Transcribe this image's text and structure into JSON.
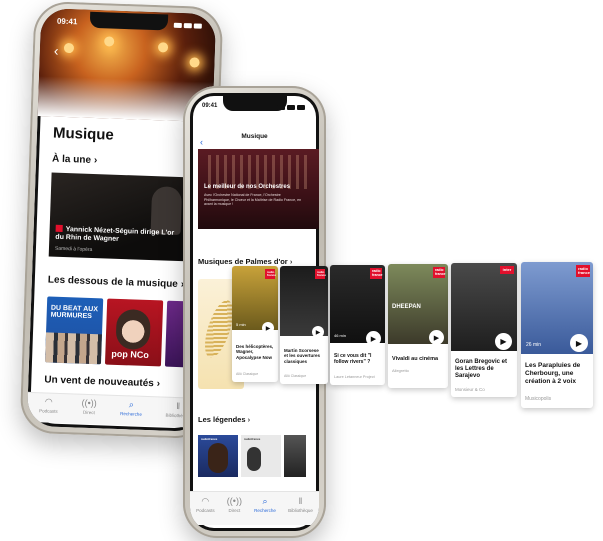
{
  "phone1": {
    "status_time": "09:41",
    "page_title": "Musique",
    "section_une": "À la une",
    "feature": {
      "title": "Yannick Nézet-Séguin dirige L'or du Rhin de Wagner",
      "subtitle": "Samedi à l'opéra"
    },
    "section_dessous": "Les dessous de la musique",
    "dessous_cards": [
      {
        "text": "DU BEAT AUX MURMURES"
      },
      {
        "text": "pop NCo"
      }
    ],
    "section_nouveautes": "Un vent de nouveautés",
    "tabs": [
      "Podcasts",
      "Direct",
      "Recherche",
      "Bibliothèque"
    ]
  },
  "phone2": {
    "status_time": "09:41",
    "header_title": "Musique",
    "feature": {
      "title": "Le meilleur de nos Orchestres",
      "description": "Avec l'Orchestre National de France, l'Orchestre Philharmonique, le Chœur et la Maîtrise de Radio France, en avant la musique !"
    },
    "section_palmes": "Musiques de Palmes d'or",
    "section_legendes": "Les légendes",
    "legend_logo": "radiofrance",
    "tabs": [
      "Podcasts",
      "Direct",
      "Recherche",
      "Bibliothèque"
    ]
  },
  "cards": [
    {
      "title": "Des hélicoptères, Wagner, Apocalypse Now",
      "subtitle": "Allô Classique",
      "duration": "5 min",
      "badge": "radio france"
    },
    {
      "title": "Martin Scorsese et les ouvertures classiques",
      "subtitle": "Allô Classique",
      "duration": "",
      "badge": "radio france"
    },
    {
      "title": "Si ce vous dit \"I follow rivers\" ?",
      "subtitle": "Laure Letanneur Project",
      "duration": "46 min",
      "badge": "radio france"
    },
    {
      "title": "Vivaldi au cinéma",
      "subtitle": "Allegretto",
      "duration": "",
      "badge": "radio france",
      "thumb_text": "DHEEPAN"
    },
    {
      "title": "Goran Bregovic et les Lettres de Sarajevo",
      "subtitle": "Monsieur & Co",
      "duration": "",
      "badge": "inter"
    },
    {
      "title": "Les Parapluies de Cherbourg, une création à 2 voix",
      "subtitle": "Musicopolis",
      "duration": "26 min",
      "badge": "radio france"
    }
  ],
  "colors": {
    "accent": "#2a69d8",
    "brand_red": "#e1102c"
  },
  "icons": {
    "tab_podcasts": "headphones-icon",
    "tab_direct": "radio-waves-icon",
    "tab_recherche": "search-icon",
    "tab_bibliotheque": "library-icon",
    "play": "play-icon"
  }
}
